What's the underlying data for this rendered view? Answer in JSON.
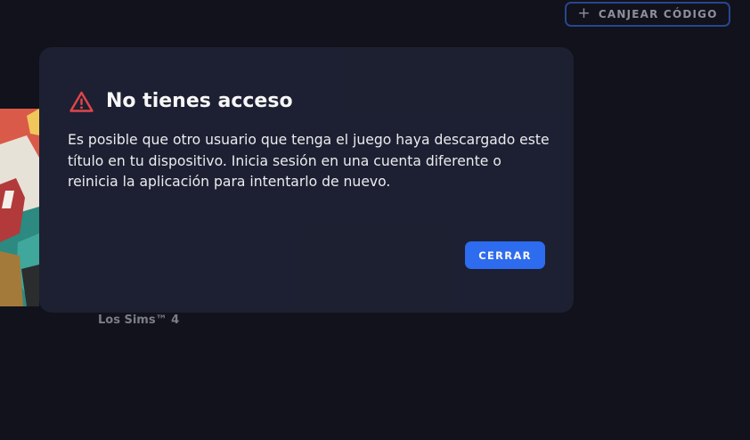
{
  "header": {
    "redeem_icon": "plus-icon",
    "redeem_label": "CANJEAR CÓDIGO"
  },
  "library": {
    "tiles": [
      {
        "title": ""
      },
      {
        "title": "Los Sims™ 4"
      }
    ]
  },
  "dialog": {
    "icon": "warning-triangle-icon",
    "title": "No tienes acceso",
    "message": "Es posible que otro usuario que tenga el juego haya descargado este título en tu dispositivo. Inicia sesión en una cuenta diferente o reinicia la aplicación para intentarlo de nuevo.",
    "close_label": "CERRAR"
  },
  "colors": {
    "background": "#11121b",
    "dialog": "#1e2133",
    "accent": "#2e6ef6",
    "warning": "#e8474d"
  }
}
